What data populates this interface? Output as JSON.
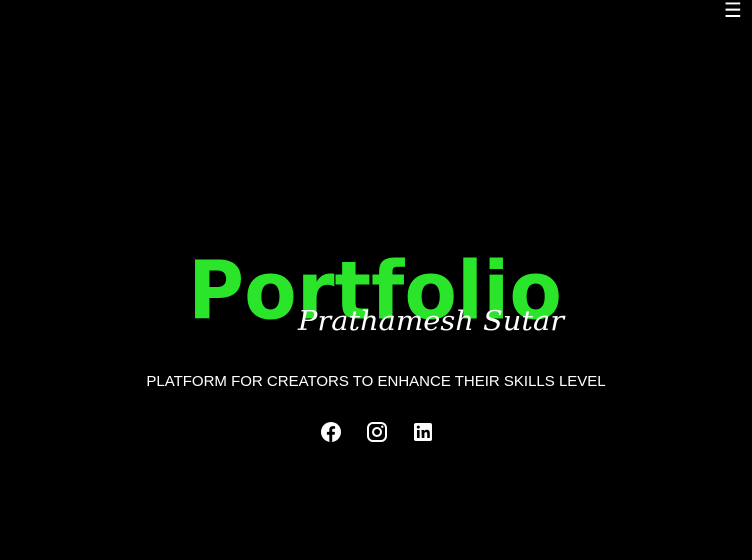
{
  "header": {
    "menu_icon": "hamburger-menu-icon",
    "menu_glyph": "☰"
  },
  "hero": {
    "logo_title": "Portfolio",
    "logo_signature": "Prathamesh Sutar",
    "tagline": "PLATFORM FOR CREATORS TO ENHANCE THEIR SKILLS LEVEL"
  },
  "social": [
    {
      "icon": "facebook-icon"
    },
    {
      "icon": "instagram-icon"
    },
    {
      "icon": "linkedin-icon"
    }
  ],
  "colors": {
    "background": "#000000",
    "logo_green": "#2be52b",
    "text": "#ffffff"
  }
}
